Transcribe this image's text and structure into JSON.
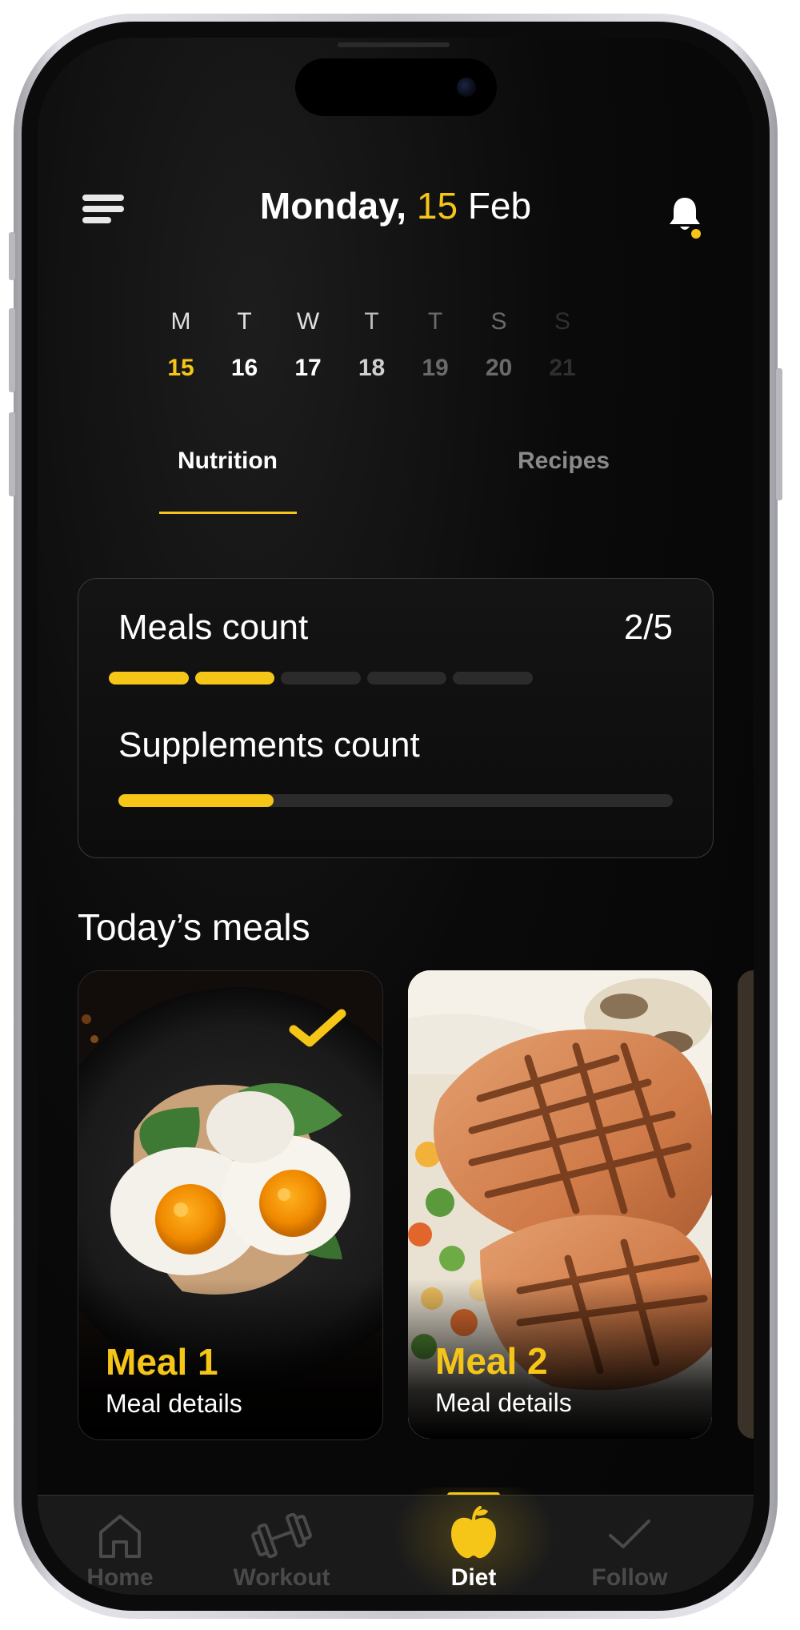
{
  "header": {
    "weekday": "Monday,",
    "day_number": "15",
    "month": "Feb"
  },
  "week": [
    {
      "letter": "M",
      "number": "15",
      "state": "selected"
    },
    {
      "letter": "T",
      "number": "16",
      "state": "normal"
    },
    {
      "letter": "W",
      "number": "17",
      "state": "normal"
    },
    {
      "letter": "T",
      "number": "18",
      "state": "dim"
    },
    {
      "letter": "T",
      "number": "19",
      "state": "dimmer"
    },
    {
      "letter": "S",
      "number": "20",
      "state": "dimmer"
    },
    {
      "letter": "S",
      "number": "21",
      "state": "faded"
    }
  ],
  "tabs": {
    "nutrition": "Nutrition",
    "recipes": "Recipes",
    "active": "Nutrition"
  },
  "progress": {
    "meals_label": "Meals count",
    "meals_value": "2/5",
    "meals_done": 2,
    "meals_total": 5,
    "supplements_label": "Supplements count",
    "supplements_fraction": 0.28
  },
  "section_title": "Today’s meals",
  "meals": [
    {
      "name": "Meal 1",
      "detail": "Meal details",
      "completed": true
    },
    {
      "name": "Meal 2",
      "detail": "Meal details",
      "completed": false
    }
  ],
  "nav": {
    "home": "Home",
    "workout": "Workout",
    "diet": "Diet",
    "follow": "Follow",
    "active": "Diet"
  },
  "colors": {
    "accent": "#f5c518",
    "background": "#050505",
    "inactive_nav": "#4a4a4a"
  }
}
